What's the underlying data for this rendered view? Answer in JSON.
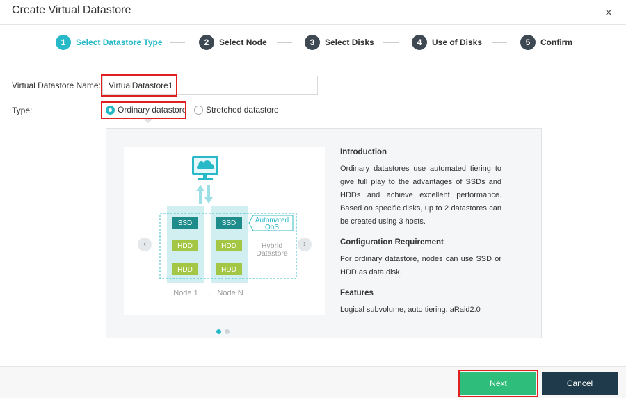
{
  "dialog": {
    "title": "Create Virtual Datastore",
    "close_glyph": "×"
  },
  "steps": [
    {
      "num": "1",
      "label": "Select Datastore Type",
      "active": true
    },
    {
      "num": "2",
      "label": "Select Node",
      "active": false
    },
    {
      "num": "3",
      "label": "Select Disks",
      "active": false
    },
    {
      "num": "4",
      "label": "Use of Disks",
      "active": false
    },
    {
      "num": "5",
      "label": "Confirm",
      "active": false
    }
  ],
  "form": {
    "name_label": "Virtual Datastore Name:",
    "name_value": "VirtualDatastore1",
    "type_label": "Type:",
    "type_options": [
      {
        "label": "Ordinary datastore",
        "checked": true
      },
      {
        "label": "Stretched datastore",
        "checked": false
      }
    ]
  },
  "figure": {
    "ssd": "SSD",
    "hdd": "HDD",
    "automated_qos_1": "Automated",
    "automated_qos_2": "QoS",
    "hybrid_1": "Hybrid",
    "hybrid_2": "Datastore",
    "node_1": "Node 1",
    "ellipsis": "...",
    "node_n": "Node N"
  },
  "info": {
    "intro_title": "Introduction",
    "intro_text": "Ordinary datastores use automated tiering to give full play to the advantages of SSDs and HDDs and achieve excellent performance. Based on specific disks, up to 2 datastores can be created using 3 hosts.",
    "req_title": "Configuration Requirement",
    "req_text": "For ordinary datastore, nodes can use SSD or HDD as data disk.",
    "features_title": "Features",
    "features_text": "Logical subvolume, auto tiering, aRaid2.0"
  },
  "carousel": {
    "prev_glyph": "‹",
    "next_glyph": "›",
    "pages": 2,
    "current": 1
  },
  "footer": {
    "next_label": "Next",
    "cancel_label": "Cancel"
  },
  "colors": {
    "accent": "#27b9c7",
    "step_inactive": "#3d4853",
    "next_button": "#2ebd7a",
    "cancel_button": "#1f3a4a",
    "highlight_box": "#e02020",
    "ssd_block": "#1f8c8c",
    "hdd_block": "#a3c644"
  }
}
